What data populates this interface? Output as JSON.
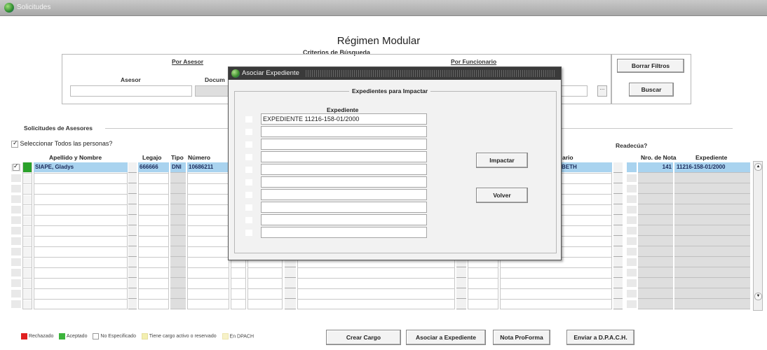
{
  "window": {
    "title": "Solicitudes"
  },
  "page": {
    "title": "Régimen Modular",
    "criteria_title": "Criterios de Búsqueda"
  },
  "search": {
    "por_asesor": "Por Asesor",
    "asesor_label": "Asesor",
    "documento_label": "Docum",
    "por_funcionario": "Por Funcionario",
    "borrar": "Borrar Filtros",
    "buscar": "Buscar",
    "dots": "..."
  },
  "section": {
    "title": "Solicitudes de Asesores",
    "select_all": "Seleccionar Todos las personas?",
    "readecua": "Readecúa?"
  },
  "columns": {
    "apellido": "Apellido y Nombre",
    "legajo": "Legajo",
    "tipo": "Tipo",
    "numero": "Número",
    "funcionario": "ario",
    "nro_nota": "Nro. de Nota",
    "expediente": "Expediente"
  },
  "first_row": {
    "apellido": "SIAPE, Gladys",
    "legajo": "666666",
    "tipo": "DNI",
    "numero": "10686211",
    "funcionario": "BETH",
    "nro_nota": "141",
    "expediente": "11216-158-01/2000"
  },
  "modal": {
    "title": "Asociar Expediente",
    "frame_title": "Expedientes para Impactar",
    "column": "Expediente",
    "rows": [
      "EXPEDIENTE 11216-158-01/2000",
      "",
      "",
      "",
      "",
      "",
      "",
      "",
      "",
      ""
    ],
    "impactar": "Impactar",
    "volver": "Volver"
  },
  "legend": [
    {
      "label": "Rechazado",
      "color": "#e02020"
    },
    {
      "label": "Aceptado",
      "color": "#3cb43c"
    },
    {
      "label": "No Especificado",
      "color": "#ffffff"
    },
    {
      "label": "Tiene cargo activo o reservado",
      "color": "#f3efb0"
    },
    {
      "label": "En DPACH",
      "color": "#f7f2c8"
    }
  ],
  "buttons": {
    "crear_cargo": "Crear Cargo",
    "asociar": "Asociar a Expediente",
    "proforma": "Nota ProForma",
    "enviar": "Enviar a D.P.A.C.H."
  }
}
